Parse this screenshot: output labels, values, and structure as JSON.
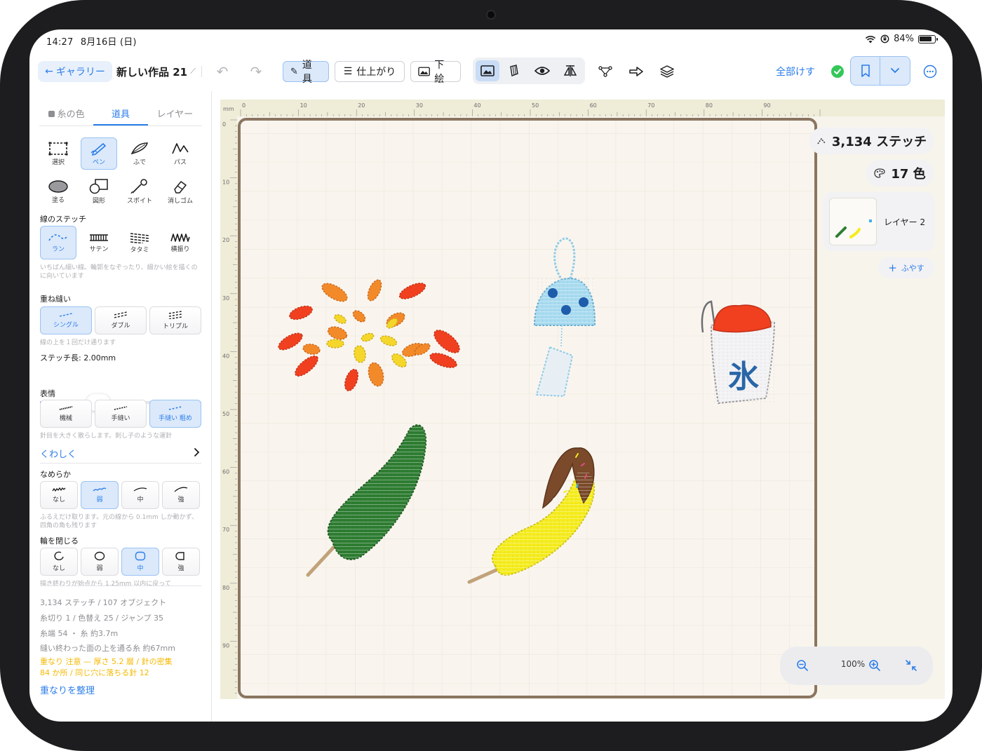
{
  "status": {
    "time": "14:27",
    "date": "8月16日 (日)",
    "battery": "84%"
  },
  "toolbar": {
    "gallery": "ギャラリー",
    "title": "新しい作品 21",
    "mode_tools": "道具",
    "mode_finish": "仕上がり",
    "mode_underlay": "下絵",
    "erase_all": "全部けす"
  },
  "panel": {
    "tabs": [
      "糸の色",
      "道具",
      "レイヤー"
    ],
    "tools": [
      "選択",
      "ペン",
      "ふで",
      "パス",
      "塗る",
      "図形",
      "スポイト",
      "消しゴム"
    ],
    "stitch_section": "線のステッチ",
    "stitch_types": [
      "ラン",
      "サテン",
      "タタミ",
      "横振り"
    ],
    "stitch_hint": "いちばん細い線。輪郭をなぞったり、細かい絵を描くのに向いています",
    "repeat_section": "重ね縫い",
    "repeat_options": [
      "シングル",
      "ダブル",
      "トリプル"
    ],
    "repeat_hint": "線の上を１回だけ通ります",
    "stitch_length": "ステッチ長: 2.00mm",
    "stitch_length_fraction": 0.36,
    "expression_section": "表情",
    "expression_options": [
      "機械",
      "手縫い",
      "手縫い 粗め"
    ],
    "expression_hint": "針目を大きく散らします。刺し子のような運針",
    "details": "くわしく",
    "smooth_section": "なめらか",
    "smooth_options": [
      "なし",
      "弱",
      "中",
      "強"
    ],
    "smooth_hint": "ふるえだけ取ります。元の線から 0.1mm しか動かず、四角の角も残ります",
    "close_section": "輪を閉じる",
    "close_options": [
      "なし",
      "弱",
      "中",
      "強"
    ],
    "close_hint": "描き終わりが始点から 1.25mm 以内に戻って",
    "stats": [
      "3,134 ステッチ / 107 オブジェクト",
      "糸切り 1 / 色替え 25 / ジャンプ 35",
      "糸端 54 ・ 糸 約3.7m",
      "縫い終わった面の上を通る糸 約67mm"
    ],
    "warning_1": "重なり 注意 — 厚さ 5.2 層 / 針の密集",
    "warning_2": "84 か所 / 同じ穴に落ちる針 12",
    "organize": "重なりを整理"
  },
  "canvas": {
    "unit": "mm",
    "ruler_x": [
      "0",
      "10",
      "20",
      "30",
      "40",
      "50",
      "60",
      "70",
      "80",
      "90"
    ],
    "ruler_y": [
      "0",
      "10",
      "20",
      "30",
      "40",
      "50",
      "60",
      "70",
      "80",
      "90"
    ],
    "stitch_count": "3,134 ステッチ",
    "color_count": "17 色",
    "layer_name": "レイヤー 2",
    "add_layer": "ふやす",
    "zoom": "100%",
    "kanji_ice": "氷"
  },
  "colors": {
    "accent": "#2b7de9",
    "frame": "#8a7560",
    "warning": "#f5b800",
    "ok": "#34c759"
  }
}
